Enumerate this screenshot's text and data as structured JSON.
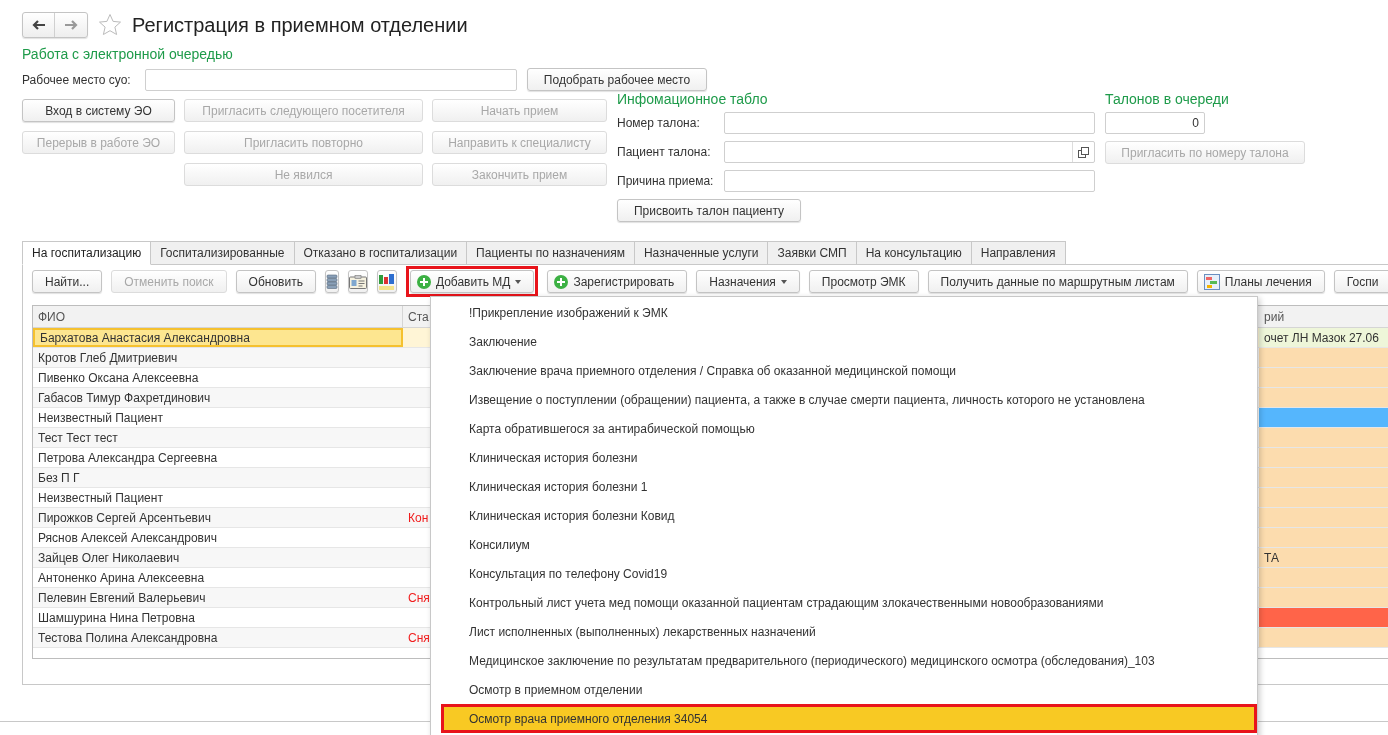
{
  "window": {
    "title": "Регистрация в приемном отделении",
    "favorite": false
  },
  "queue": {
    "title": "Работа с электронной очередью",
    "workplace_label": "Рабочее место суо:",
    "pick_button": "Подобрать рабочее место",
    "button_columns": [
      [
        {
          "label": "Вход в систему ЭО",
          "disabled": false
        },
        {
          "label": "Перерыв в работе ЭО",
          "disabled": true
        }
      ],
      [
        {
          "label": "Пригласить следующего посетителя",
          "disabled": true
        },
        {
          "label": "Пригласить повторно",
          "disabled": true
        },
        {
          "label": "Не явился",
          "disabled": true
        }
      ],
      [
        {
          "label": "Начать прием",
          "disabled": true
        },
        {
          "label": "Направить к специалисту",
          "disabled": true
        },
        {
          "label": "Закончить прием",
          "disabled": true
        }
      ]
    ]
  },
  "info_board": {
    "title": "Инфомационное табло",
    "fields": [
      {
        "label": "Номер талона:",
        "kind": "text"
      },
      {
        "label": "Пациент талона:",
        "kind": "picker"
      },
      {
        "label": "Причина приема:",
        "kind": "text"
      }
    ],
    "assign_button": "Присвоить талон пациенту"
  },
  "tickets": {
    "title": "Талонов в очереди",
    "count": "0",
    "invite_button": {
      "label": "Пригласить по номеру талона",
      "disabled": true
    }
  },
  "tabs": [
    {
      "label": "На госпитализацию",
      "selected": true
    },
    {
      "label": "Госпитализированные",
      "selected": false
    },
    {
      "label": "Отказано в госпитализации",
      "selected": false
    },
    {
      "label": "Пациенты по назначениям",
      "selected": false
    },
    {
      "label": "Назначенные услуги",
      "selected": false
    },
    {
      "label": "Заявки СМП",
      "selected": false
    },
    {
      "label": "На консультацию",
      "selected": false
    },
    {
      "label": "Направления",
      "selected": false
    }
  ],
  "toolbar": [
    {
      "kind": "text",
      "label": "Найти...",
      "disabled": false
    },
    {
      "kind": "text",
      "label": "Отменить поиск",
      "disabled": true
    },
    {
      "kind": "text",
      "label": "Обновить",
      "disabled": false
    },
    {
      "kind": "list-icon"
    },
    {
      "kind": "card-icon"
    },
    {
      "kind": "sort-icon"
    },
    {
      "kind": "plus",
      "label": "Добавить МД",
      "disabled": false,
      "dropdown": true,
      "outlined": true
    },
    {
      "kind": "plus",
      "label": "Зарегистрировать",
      "disabled": false
    },
    {
      "kind": "text",
      "label": "Назначения",
      "disabled": false,
      "dropdown": true
    },
    {
      "kind": "text",
      "label": "Просмотр ЭМК",
      "disabled": false
    },
    {
      "kind": "text",
      "label": "Получить данные по маршрутным листам",
      "disabled": false
    },
    {
      "kind": "chart",
      "label": "Планы лечения",
      "disabled": false
    },
    {
      "kind": "text",
      "label": "Госпи",
      "disabled": false
    }
  ],
  "table": {
    "columns": [
      "ФИО",
      "Ста",
      "рий"
    ],
    "rows": [
      {
        "name": "Бархатова Анастасия Александровна",
        "status": "",
        "comment": "очет ЛН Мазок 27.06",
        "color": "#eef6d9",
        "selected": true
      },
      {
        "name": "Кротов Глеб Дмитриевич",
        "status": "",
        "comment": "",
        "color": "#fcdcae",
        "selected": false
      },
      {
        "name": "Пивенко Оксана Алексеевна",
        "status": "",
        "comment": "",
        "color": "#fcdcae",
        "selected": false
      },
      {
        "name": "Габасов Тимур Фахретдинович",
        "status": "",
        "comment": "",
        "color": "#fcdcae",
        "selected": false
      },
      {
        "name": "Неизвестный Пациент",
        "status": "",
        "comment": "",
        "color": "#55b6fd",
        "selected": false
      },
      {
        "name": "Тест Тест тест",
        "status": "",
        "comment": "",
        "color": "#fcdcae",
        "selected": false
      },
      {
        "name": "Петрова Александра Сергеевна",
        "status": "",
        "comment": "",
        "color": "#fcdcae",
        "selected": false
      },
      {
        "name": "Без П Г",
        "status": "",
        "comment": "",
        "color": "#fcdcae",
        "selected": false
      },
      {
        "name": "Неизвестный Пациент",
        "status": "",
        "comment": "",
        "color": "#fcdcae",
        "selected": false
      },
      {
        "name": "Пирожков Сергей Арсентьевич",
        "status": "Кон",
        "comment": "",
        "color": "#fcdcae",
        "selected": false
      },
      {
        "name": "Ряснов Алексей Александрович",
        "status": "",
        "comment": "",
        "color": "#fcdcae",
        "selected": false
      },
      {
        "name": "Зайцев Олег Николаевич",
        "status": "",
        "comment": "ТА",
        "color": "#fcdcae",
        "selected": false
      },
      {
        "name": "Антоненко Арина Алексеевна",
        "status": "",
        "comment": "",
        "color": "#fcdcae",
        "selected": false
      },
      {
        "name": "Пелевин Евгений Валерьевич",
        "status": "Сня",
        "comment": "",
        "color": "#fcdcae",
        "selected": false
      },
      {
        "name": "Шамшурина Нина Петровна",
        "status": "",
        "comment": "",
        "color": "#ff6449",
        "selected": false
      },
      {
        "name": "Тестова Полина Александровна",
        "status": "Сня",
        "comment": "",
        "color": "#fcdcae",
        "selected": false
      }
    ]
  },
  "menu": [
    {
      "label": "!Прикрепление изображений к ЭМК",
      "selected": false,
      "outlined": false
    },
    {
      "label": "Заключение",
      "selected": false,
      "outlined": false
    },
    {
      "label": "Заключение врача приемного отделения / Справка об оказанной медицинской помощи",
      "selected": false,
      "outlined": false
    },
    {
      "label": "Извещение о поступлении (обращении) пациента, а также в случае смерти пациента, личность которого не установлена",
      "selected": false,
      "outlined": false
    },
    {
      "label": "Карта обратившегося за антирабической помощью",
      "selected": false,
      "outlined": false
    },
    {
      "label": "Клиническая история болезни",
      "selected": false,
      "outlined": false
    },
    {
      "label": "Клиническая история болезни 1",
      "selected": false,
      "outlined": false
    },
    {
      "label": "Клиническая история болезни Ковид",
      "selected": false,
      "outlined": false
    },
    {
      "label": "Консилиум",
      "selected": false,
      "outlined": false
    },
    {
      "label": "Консультация по телефону Covid19",
      "selected": false,
      "outlined": false
    },
    {
      "label": "Контрольный лист учета мед помощи оказанной пациентам страдающим злокачественными новообразованиями",
      "selected": false,
      "outlined": false
    },
    {
      "label": "Лист исполненных (выполненных) лекарственных назначений",
      "selected": false,
      "outlined": false
    },
    {
      "label": "Медицинское заключение по результатам предварительного (периодического) медицинского осмотра (обследования)_103",
      "selected": false,
      "outlined": false
    },
    {
      "label": "Осмотр в приемном отделении",
      "selected": false,
      "outlined": false
    },
    {
      "label": "Осмотр врача приемного отделения 34054",
      "selected": true,
      "outlined": true
    }
  ]
}
